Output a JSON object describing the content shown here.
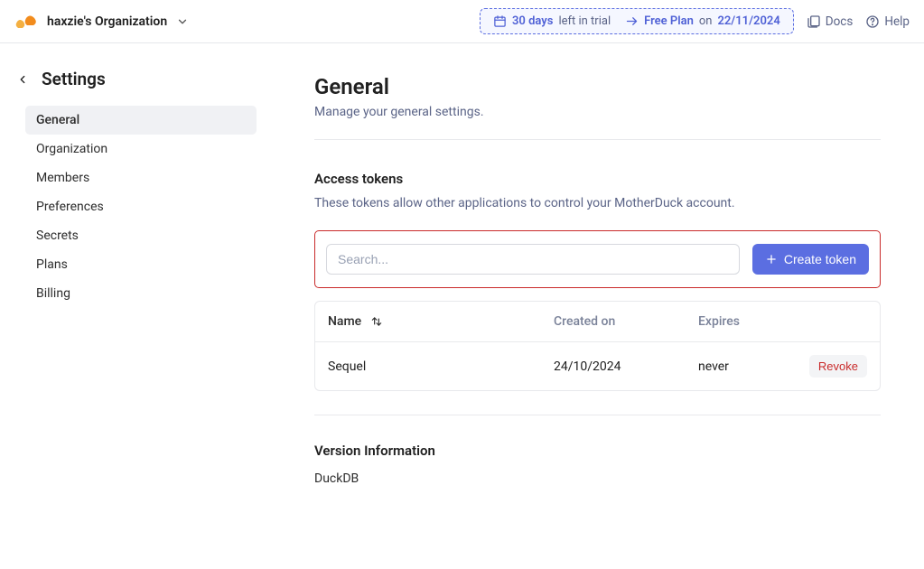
{
  "header": {
    "org_name": "haxzie's Organization",
    "trial": {
      "days": "30 days",
      "days_suffix": "left in trial",
      "plan": "Free Plan",
      "plan_mid": "on",
      "date": "22/11/2024"
    },
    "docs_label": "Docs",
    "help_label": "Help"
  },
  "sidebar": {
    "title": "Settings",
    "items": [
      {
        "label": "General"
      },
      {
        "label": "Organization"
      },
      {
        "label": "Members"
      },
      {
        "label": "Preferences"
      },
      {
        "label": "Secrets"
      },
      {
        "label": "Plans"
      },
      {
        "label": "Billing"
      }
    ]
  },
  "page": {
    "title": "General",
    "subtitle": "Manage your general settings."
  },
  "tokens": {
    "title": "Access tokens",
    "description": "These tokens allow other applications to control your MotherDuck account.",
    "search_placeholder": "Search...",
    "create_label": "Create token",
    "columns": {
      "name": "Name",
      "created": "Created on",
      "expires": "Expires"
    },
    "rows": [
      {
        "name": "Sequel",
        "created": "24/10/2024",
        "expires": "never",
        "action": "Revoke"
      }
    ]
  },
  "version": {
    "title": "Version Information",
    "item": "DuckDB"
  }
}
